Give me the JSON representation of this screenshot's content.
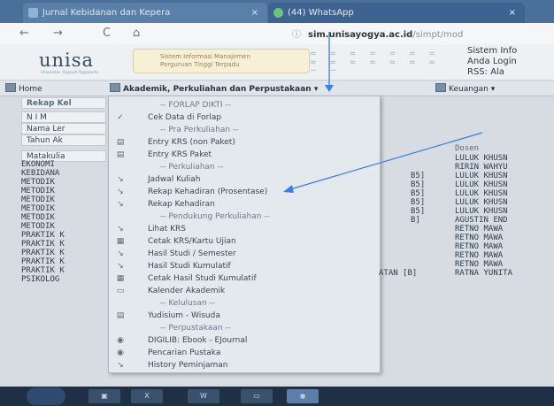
{
  "browser": {
    "tabs": [
      {
        "title": "Jurnal Kebidanan dan Kepera",
        "close": "×"
      },
      {
        "title": "(44) WhatsApp",
        "close": "×"
      }
    ],
    "url_domain": "sim.unisayogya.ac.id",
    "url_path": "/simpt/mod",
    "nav": {
      "back": "←",
      "forward": "→",
      "reload": "C",
      "home": "⌂"
    }
  },
  "header": {
    "logo": "unisa",
    "logo_sub": "Universitas 'Aisyiyah Yogyakarta",
    "banner_line1": "Sistem Informasi Manajemen",
    "banner_line2": "Perguruan Tinggi Terpadu",
    "pattern": "= = = = = = = = = = = = = = = =",
    "sysinfo_line1": "Sistem Info",
    "sysinfo_line2": "Anda Login",
    "sysinfo_line3": "RSS:      Ala"
  },
  "menubar": {
    "home": "Home",
    "akademik": "Akademik, Perkuliahan dan Perpustakaan",
    "keuangan": "Keuangan"
  },
  "left_panel": {
    "title": "Rekap Kel",
    "fields": [
      "N I M",
      "Nama Ler",
      "Tahun Ak"
    ],
    "col_header": "Matakulia",
    "courses": [
      "EKONOMI",
      "KEBIDANA",
      "METODIK",
      "METODIK",
      "METODIK",
      "METODIK",
      "METODIK",
      "METODIK",
      "PRAKTIK K",
      "PRAKTIK K",
      "PRAKTIK K",
      "PRAKTIK K",
      "PRAKTIK K",
      "PSIKOLOG"
    ]
  },
  "dropdown": {
    "items": [
      {
        "label": "-- FORLAP DIKTI --",
        "icon": "",
        "section": true
      },
      {
        "label": "Cek Data di Forlap",
        "icon": "check-icon",
        "section": false
      },
      {
        "label": "-- Pra Perkuliahan --",
        "icon": "",
        "section": true
      },
      {
        "label": "Entry KRS (non Paket)",
        "icon": "form-icon",
        "section": false
      },
      {
        "label": "Entry KRS Paket",
        "icon": "form-icon",
        "section": false
      },
      {
        "label": "-- Perkuliahan --",
        "icon": "",
        "section": true
      },
      {
        "label": "Jadwal Kuliah",
        "icon": "arrow-icon",
        "section": false
      },
      {
        "label": "Rekap Kehadiran (Prosentase)",
        "icon": "arrow-icon",
        "section": false
      },
      {
        "label": "Rekap Kehadiran",
        "icon": "arrow-icon",
        "section": false
      },
      {
        "label": "-- Pendukung Perkuliahan --",
        "icon": "",
        "section": true
      },
      {
        "label": "Lihat KRS",
        "icon": "arrow-icon",
        "section": false
      },
      {
        "label": "Cetak KRS/Kartu Ujian",
        "icon": "print-icon",
        "section": false
      },
      {
        "label": "Hasil Studi / Semester",
        "icon": "arrow-icon",
        "section": false
      },
      {
        "label": "Hasil Studi Kumulatif",
        "icon": "arrow-icon",
        "section": false
      },
      {
        "label": "Cetak Hasil Studi Kumulatif",
        "icon": "print-icon",
        "section": false
      },
      {
        "label": "Kalender Akademik",
        "icon": "calendar-icon",
        "section": false
      },
      {
        "label": "-- Kelulusan --",
        "icon": "",
        "section": true
      },
      {
        "label": "Yudisium - Wisuda",
        "icon": "form-icon",
        "section": false
      },
      {
        "label": "-- Perpustakaan --",
        "icon": "",
        "section": true
      },
      {
        "label": "DIGILIB: Ebook - EJournal",
        "icon": "binoculars-icon",
        "section": false
      },
      {
        "label": "Pencarian Pustaka",
        "icon": "binoculars-icon",
        "section": false
      },
      {
        "label": "History Peminjaman",
        "icon": "arrow-icon",
        "section": false
      }
    ]
  },
  "right_panel": {
    "dosen_header": "Dosen",
    "rows": [
      {
        "kelas": "",
        "dosen": "LULUK KHUSN"
      },
      {
        "kelas": "",
        "dosen": "RIRIN WAHYU"
      },
      {
        "kelas": "B5]",
        "dosen": "LULUK KHUSN"
      },
      {
        "kelas": "B5]",
        "dosen": "LULUK KHUSN"
      },
      {
        "kelas": "B5]",
        "dosen": "LULUK KHUSN"
      },
      {
        "kelas": "B5]",
        "dosen": "LULUK KHUSN"
      },
      {
        "kelas": "B5]",
        "dosen": "LULUK KHUSN"
      },
      {
        "kelas": "B]",
        "dosen": "AGUSTIN END"
      },
      {
        "kelas": "",
        "dosen": "RETNO MAWA"
      },
      {
        "kelas": "",
        "dosen": "RETNO MAWA"
      },
      {
        "kelas": "",
        "dosen": "RETNO MAWA"
      },
      {
        "kelas": "",
        "dosen": "RETNO MAWA"
      },
      {
        "kelas": "",
        "dosen": "RETNO MAWA"
      },
      {
        "kelas": "ATAN [B]",
        "dosen": "RATNA YUNITA"
      }
    ]
  },
  "colors": {
    "accent": "#4a6f99",
    "annotation": "#3b7fe0"
  }
}
